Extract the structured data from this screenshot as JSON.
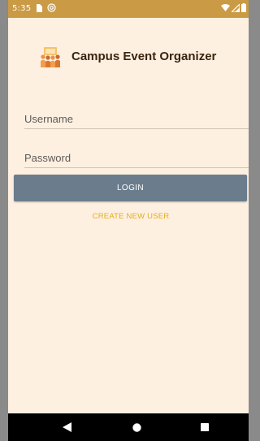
{
  "status_bar": {
    "time": "5:35",
    "icons": [
      "sim-card-icon",
      "at-sign-icon",
      "wifi-icon",
      "signal-icon",
      "battery-icon"
    ]
  },
  "header": {
    "title": "Campus Event Organizer",
    "logo_icon": "campus-crowd-logo"
  },
  "form": {
    "username_placeholder": "Username",
    "password_placeholder": "Password",
    "login_label": "LOGIN",
    "create_user_label": "CREATE NEW USER"
  },
  "nav_bar": {
    "icons": [
      "back-icon",
      "home-icon",
      "recents-icon"
    ]
  },
  "colors": {
    "status_bar": "#ca9a45",
    "background": "#fdf0e1",
    "login_button": "#6b7d8d",
    "link": "#e6ac17",
    "title_text": "#3a2510",
    "nav_bar": "#000000"
  }
}
